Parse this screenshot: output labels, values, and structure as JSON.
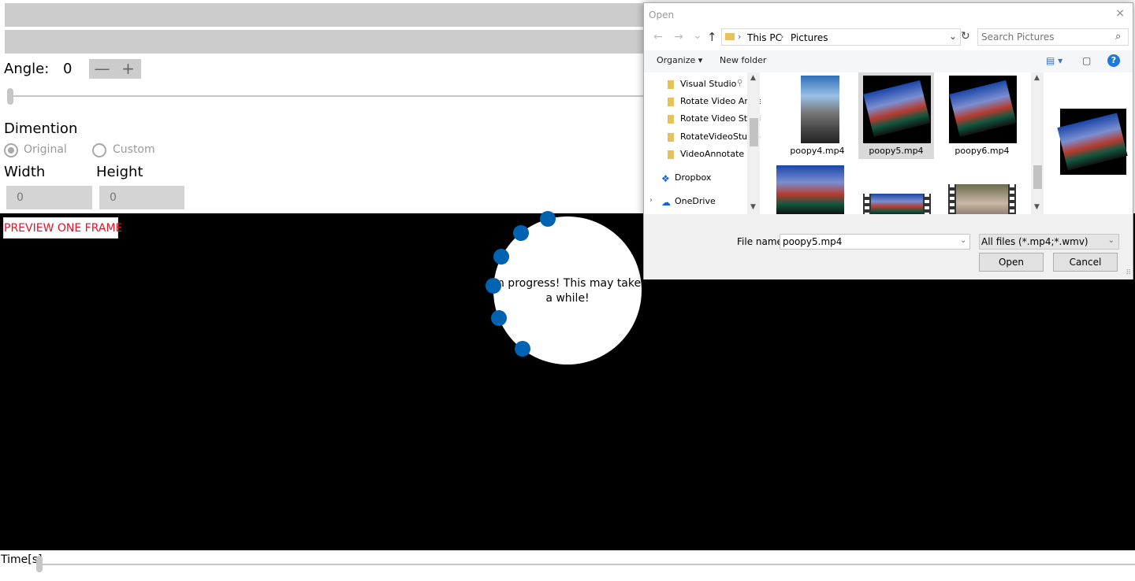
{
  "app": {
    "angle_label": "Angle:",
    "angle_value": "0",
    "stepper_minus": "—",
    "stepper_plus": "+",
    "angle_slider_fraction": 0,
    "dimension_label": "Dimention",
    "radio_original": "Original",
    "radio_custom": "Custom",
    "radio_selected": "original",
    "width_label": "Width",
    "height_label": "Height",
    "width_placeholder": "0",
    "height_placeholder": "0",
    "preview_button": "PREVIEW ONE FRAME",
    "progress_text": "In progress! This may take a while!",
    "time_label": "Time[s]",
    "time_slider_fraction": 0,
    "colors": {
      "accent_blue": "#0063b1",
      "preview_red": "#e81123",
      "bar_gray": "#cccccc"
    }
  },
  "dialog": {
    "title": "Open",
    "close_icon": "×",
    "back_icon": "←",
    "forward_icon": "→",
    "recent_icon": "⌄",
    "up_icon": "↑",
    "breadcrumb": [
      "This PC",
      "Pictures"
    ],
    "breadcrumb_sep": "›",
    "addr_drop": "⌄",
    "refresh_icon": "↻",
    "search_placeholder": "Search Pictures",
    "search_icon": "⌕",
    "organize": "Organize ▾",
    "new_folder": "New folder",
    "view_icon": "▤ ▾",
    "pane_icon": "▢",
    "help": "?",
    "nav_items": [
      {
        "label": "Visual Studio",
        "pinned": true
      },
      {
        "label": "Rotate Video Angle"
      },
      {
        "label": "Rotate Video Studio"
      },
      {
        "label": "RotateVideoStudio"
      },
      {
        "label": "VideoAnnotate"
      }
    ],
    "dropbox": "Dropbox",
    "onedrive": "OneDrive",
    "expander_icon": "›",
    "pin_icon": "⚲",
    "cloud_icon": "☁",
    "dropbox_icon": "❖",
    "scroll_up": "▲",
    "scroll_down": "▼",
    "files": [
      {
        "name": "poopy4.mp4",
        "selected": false
      },
      {
        "name": "poopy5.mp4",
        "selected": true
      },
      {
        "name": "poopy6.mp4",
        "selected": false
      }
    ],
    "file_name_label": "File name:",
    "file_name_value": "poopy5.mp4",
    "file_name_drop": "⌄",
    "filter_value": "All files (*.mp4;*.wmv)",
    "filter_drop": "⌄",
    "open_button": "Open",
    "cancel_button": "Cancel",
    "grip": "⠿"
  }
}
